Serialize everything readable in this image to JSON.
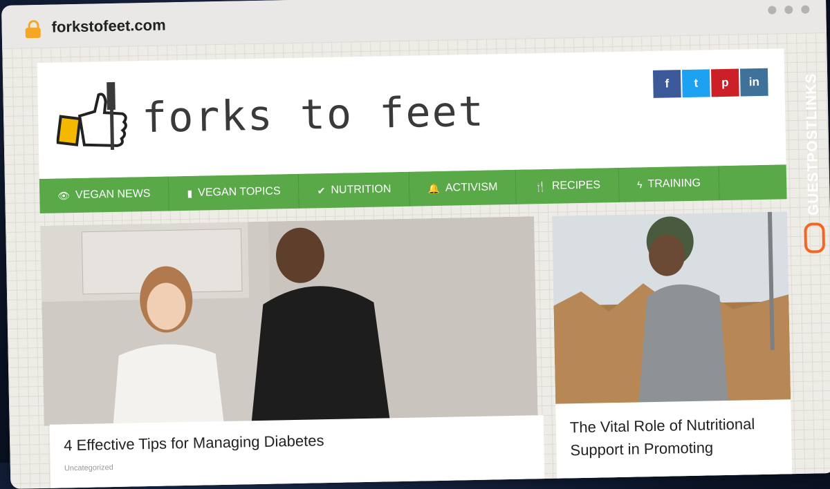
{
  "browser": {
    "url": "forkstofeet.com"
  },
  "site": {
    "logo_text": "forks to feet",
    "social": [
      {
        "label": "f",
        "icon": "facebook-icon"
      },
      {
        "label": "t",
        "icon": "twitter-icon"
      },
      {
        "label": "p",
        "icon": "pinterest-icon"
      },
      {
        "label": "in",
        "icon": "instagram-icon"
      }
    ],
    "nav": [
      {
        "label": "VEGAN NEWS",
        "icon": "eye-icon",
        "glyph": "👁"
      },
      {
        "label": "VEGAN TOPICS",
        "icon": "bookmark-icon",
        "glyph": "▮"
      },
      {
        "label": "NUTRITION",
        "icon": "check-icon",
        "glyph": "✔"
      },
      {
        "label": "ACTIVISM",
        "icon": "bell-icon",
        "glyph": "🔔"
      },
      {
        "label": "RECIPES",
        "icon": "utensils-icon",
        "glyph": "🍴"
      },
      {
        "label": "TRAINING",
        "icon": "bolt-icon",
        "glyph": "ϟ"
      }
    ],
    "articles": [
      {
        "title": "4 Effective Tips for Managing Diabetes",
        "meta": "Uncategorized"
      },
      {
        "title": "The Vital Role of Nutritional Support in Promoting"
      }
    ]
  },
  "watermark": {
    "text": "GUESTPOSTLINKS"
  }
}
